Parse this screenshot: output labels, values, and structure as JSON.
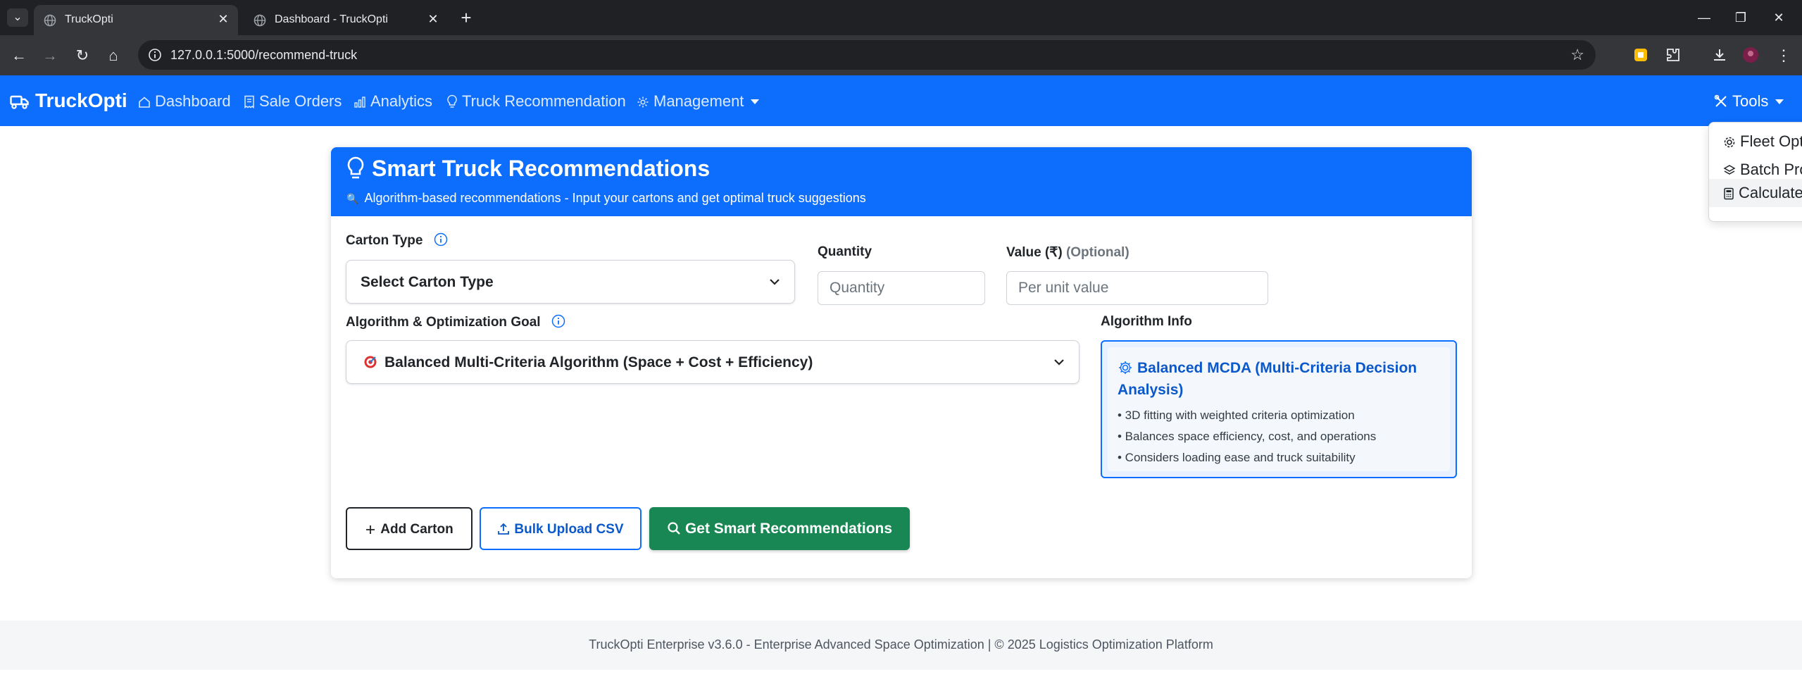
{
  "browser": {
    "tabs": [
      {
        "title": "TruckOpti",
        "active": true
      },
      {
        "title": "Dashboard - TruckOpti",
        "active": false
      }
    ],
    "url": "127.0.0.1:5000/recommend-truck"
  },
  "navbar": {
    "brand": "TruckOpti",
    "links": [
      "Dashboard",
      "Sale Orders",
      "Analytics",
      "Truck Recommendation",
      "Management"
    ],
    "tools_label": "Tools",
    "tools_menu": [
      "Fleet Opt",
      "Batch Pro",
      "Calculate"
    ]
  },
  "card": {
    "title": "Smart Truck Recommendations",
    "subtitle": "Algorithm-based recommendations - Input your cartons and get optimal truck suggestions"
  },
  "form": {
    "carton_type_label": "Carton Type",
    "carton_type_value": "Select Carton Type",
    "quantity_label": "Quantity",
    "quantity_placeholder": "Quantity",
    "value_label": "Value (₹)",
    "value_optional": "(Optional)",
    "value_placeholder": "Per unit value",
    "algorithm_label": "Algorithm & Optimization Goal",
    "algorithm_value": "Balanced Multi-Criteria Algorithm (Space + Cost + Efficiency)",
    "algorithm_info_label": "Algorithm Info"
  },
  "algorithm_info": {
    "title": "Balanced MCDA (Multi-Criteria Decision Analysis)",
    "points": [
      "• 3D fitting with weighted criteria optimization",
      "• Balances space efficiency, cost, and operations",
      "• Considers loading ease and truck suitability"
    ]
  },
  "buttons": {
    "add_carton": "Add Carton",
    "bulk_upload": "Bulk Upload CSV",
    "get_recommendations": "Get Smart Recommendations"
  },
  "footer": {
    "text": "TruckOpti Enterprise v3.6.0 - Enterprise Advanced Space Optimization | © 2025 Logistics Optimization Platform"
  },
  "colors": {
    "primary": "#0d6efd",
    "success": "#198754",
    "chrome_dark": "#202124",
    "chrome_toolbar": "#35363a"
  }
}
